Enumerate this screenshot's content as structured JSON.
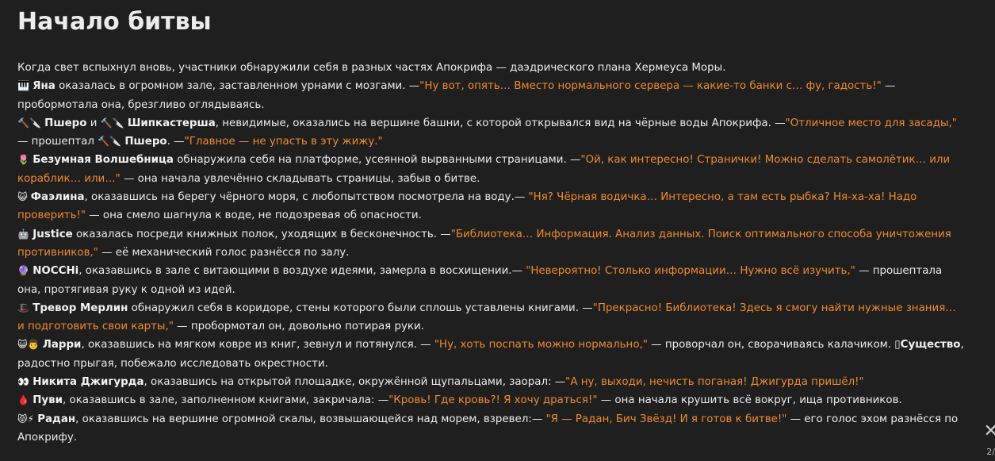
{
  "title": "Начало битвы",
  "intro": "Когда свет вспыхнул вновь, участники обнаружили себя в разных частях Апокрифа — даэдрического плана Хермеуса Моры.",
  "paragraphs": [
    {
      "emoji": "🎹",
      "name": "Яна",
      "text1": " оказалась в огромном зале, заставленном урнами с мозгами. —",
      "quote": "\"Ну вот, опять… Вместо нормального сервера — какие-то банки с… фу, гадость!\"",
      "text2": " — пробормотала она, брезгливо оглядываясь."
    },
    {
      "emoji": "🔨🔪",
      "name": "Пшеро",
      "mid": " и ",
      "emoji2": "🔨🔪",
      "name2": "Шипкастерша",
      "text1": ", невидимые, оказались на вершине башни, с которой открывался вид на чёрные воды Апокрифа. —",
      "quote": "\"Отличное место для засады,\"",
      "text2": " — прошептал ",
      "emoji3": "🔨🔪",
      "name3": "Пшеро",
      "text3": ". —",
      "quote2": "\"Главное — не упасть в эту жижу.\""
    },
    {
      "emoji": "🌷",
      "name": "Безумная Волшебница",
      "text1": " обнаружила себя на платформе, усеянной вырванными страницами. —",
      "quote": "\"Ой, как интересно! Странички! Можно сделать самолётик… или кораблик… или…\"",
      "text2": " — она начала увлечённо складывать страницы, забыв о битве."
    },
    {
      "emoji": "😺",
      "name": "Фаэлина",
      "text1": ", оказавшись на берегу чёрного моря, с любопытством посмотрела на воду.— ",
      "quote": "\"Ня? Чёрная водичка… Интересно, а там есть рыбка? Ня-ха-ха! Надо проверить!\"",
      "text2": " — она смело шагнула к воде, не подозревая об опасности."
    },
    {
      "emoji": "🤖",
      "name": "Justice",
      "text1": " оказалась посреди книжных полок, уходящих в бесконечность. —",
      "quote": "\"Библиотека… Информация. Анализ данных. Поиск оптимального способа уничтожения противников,\"",
      "text2": " — её механический голос разнёсся по залу."
    },
    {
      "emoji": "🔮",
      "name": "NOCCHi",
      "text1": ", оказавшись в зале с витающими в воздухе идеями, замерла в восхищении.— ",
      "quote": "\"Невероятно! Столько информации… Нужно всё изучить,\"",
      "text2": " — прошептала она, протягивая руку к одной из идей."
    },
    {
      "emoji": "🎩",
      "name": "Тревор Мерлин",
      "text1": " обнаружил себя в коридоре, стены которого были сплошь уставлены книгами. —",
      "quote": "\"Прекрасно! Библиотека! Здесь я смогу найти нужные знания… и подготовить свои карты,\"",
      "text2": " — пробормотал он, довольно потирая руки."
    },
    {
      "emoji": "😺👨",
      "name": "Ларри",
      "text1": ", оказавшись на мягком ковре из книг, зевнул и потянулся. — ",
      "quote": "\"Ну, хоть поспать можно нормально,\"",
      "text2": " — проворчал он, сворачиваясь калачиком. ▯",
      "name2": "Существо",
      "text3": ", радостно прыгая, побежало исследовать окрестности."
    },
    {
      "emoji": "👀",
      "name": "Никита Джигурда",
      "text1": ", оказавшись на открытой площадке, окружённой щупальцами, заорал: —",
      "quote": "\"А ну, выходи, нечисть поганая! Джигурда пришёл!\"",
      "text2": ""
    },
    {
      "emoji": "🩸",
      "name": "Пуви",
      "text1": ", оказавшись в зале, заполненном книгами, закричала: —",
      "quote": "\"Кровь! Где кровь?! Я хочу драться!\"",
      "text2": " — она начала крушить всё вокруг, ища противников."
    },
    {
      "emoji": "😾⚡",
      "name": "Радан",
      "text1": ", оказавшись на вершине огромной скалы, возвышающейся над морем, взревел:— ",
      "quote": "\"Я — Радан, Бич Звёзд! И я готов к битве!\"",
      "text2": " — его голос эхом разнёсся по Апокрифу."
    }
  ],
  "corner": {
    "close_glyph": "✕",
    "page_label": "2/"
  }
}
